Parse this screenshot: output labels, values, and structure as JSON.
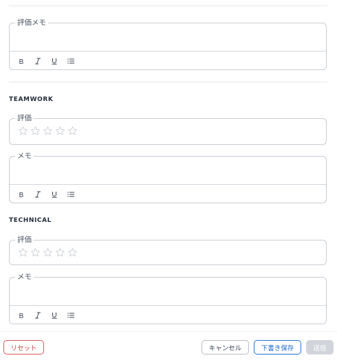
{
  "toolbar": {
    "bold": "B",
    "italic": "I",
    "underline": "U"
  },
  "top_block": {
    "memo_legend": "評価メモ"
  },
  "sections": [
    {
      "title": "TEAMWORK",
      "rating_legend": "評価",
      "rating_value": 0,
      "rating_max": 5,
      "memo_legend": "メモ"
    },
    {
      "title": "TECHNICAL",
      "rating_legend": "評価",
      "rating_value": 0,
      "rating_max": 5,
      "memo_legend": "メモ"
    }
  ],
  "footer": {
    "reset_label": "リセット",
    "cancel_label": "キャンセル",
    "draft_label": "下書き保存",
    "submit_label": "送信"
  },
  "colors": {
    "danger": "#d13f3f",
    "primary": "#1e6ac9",
    "disabled": "#d1d5db"
  }
}
